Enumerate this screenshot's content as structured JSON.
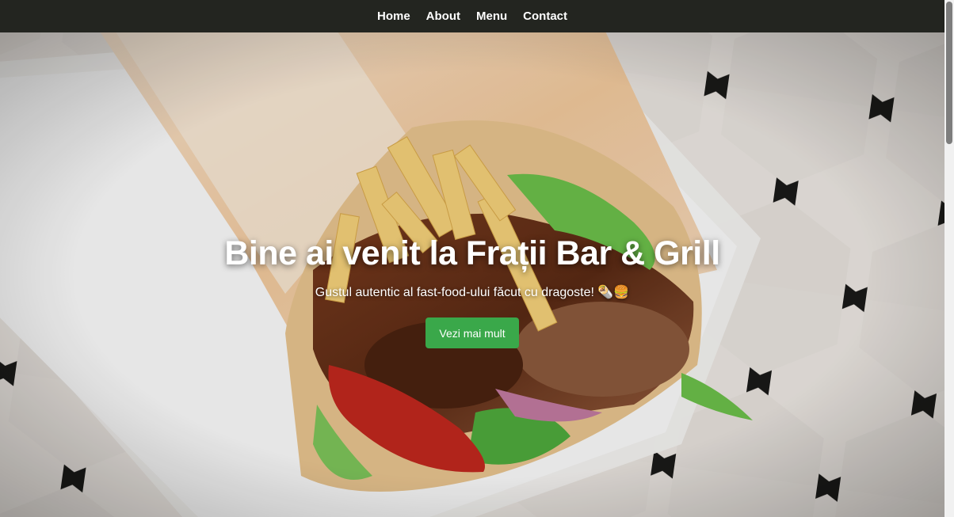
{
  "nav": {
    "items": [
      {
        "label": "Home"
      },
      {
        "label": "About"
      },
      {
        "label": "Menu"
      },
      {
        "label": "Contact"
      }
    ]
  },
  "hero": {
    "title": "Bine ai venit la Frații Bar & Grill",
    "subtitle": "Gustul autentic al fast-food-ului făcut cu dragoste! 🌯🍔",
    "cta_label": "Vezi mai mult",
    "image_subject": "shawarma-wrap-photo"
  },
  "colors": {
    "nav_bg": "#232520",
    "cta_bg": "#3aa84a",
    "text": "#ffffff"
  }
}
